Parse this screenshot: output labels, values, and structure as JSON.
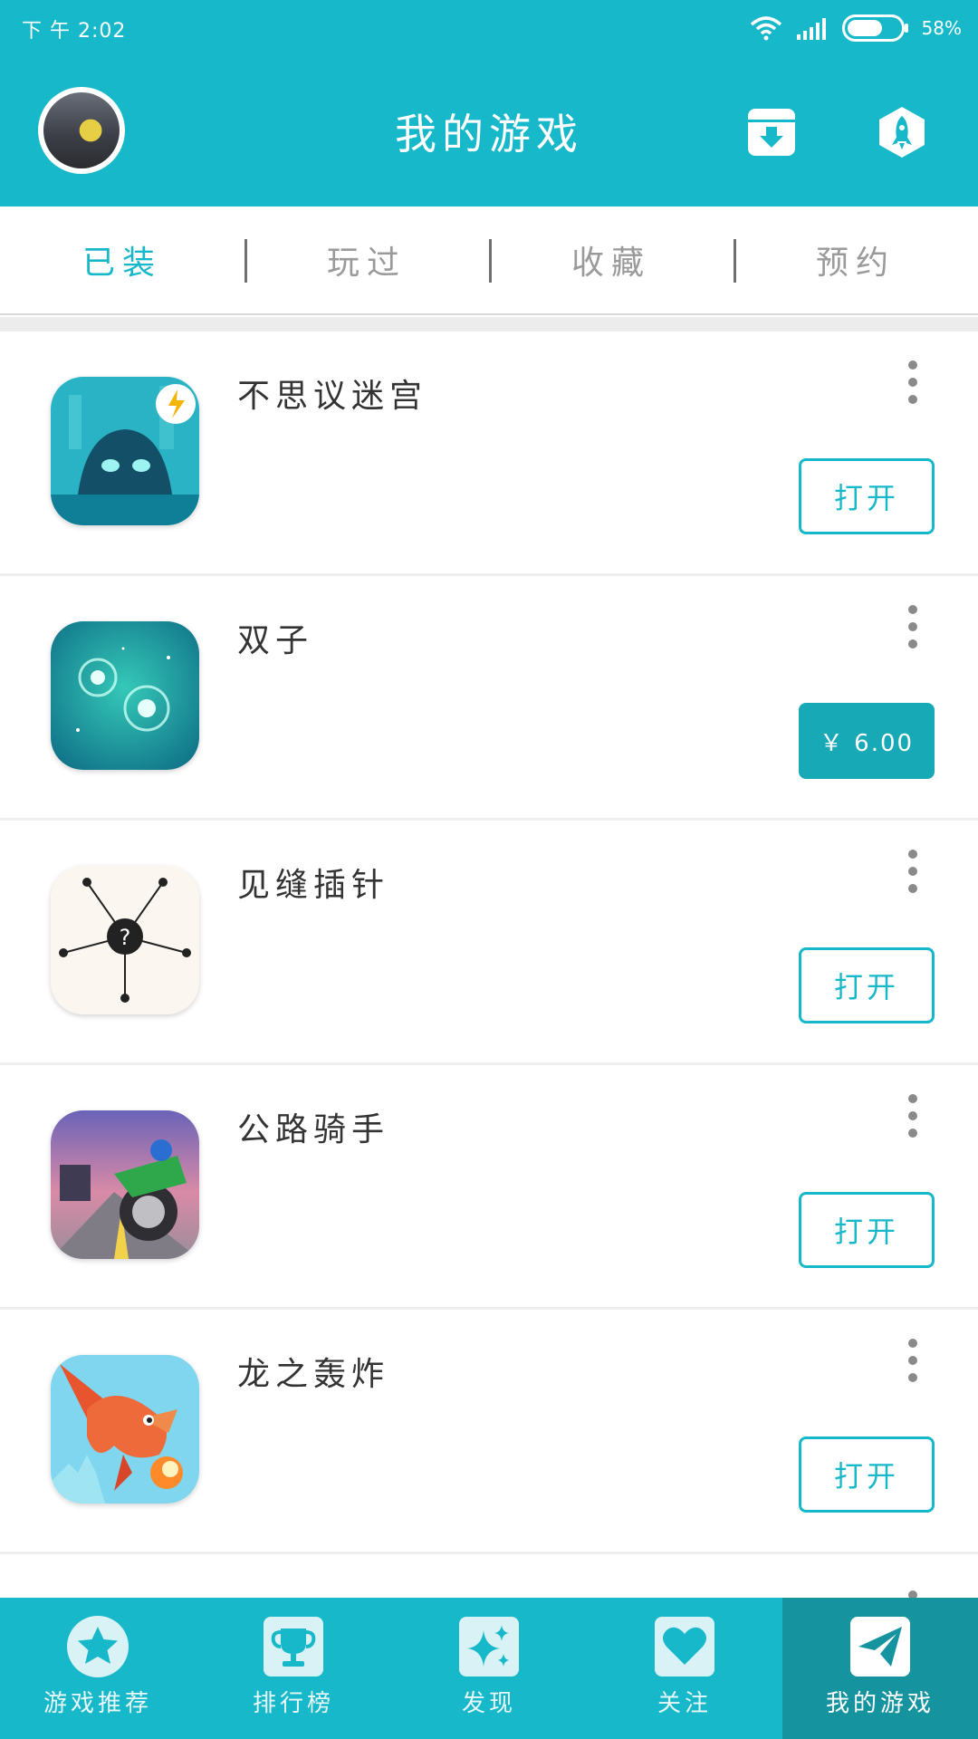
{
  "status_bar": {
    "time": "下 午 2:02",
    "battery": "58%"
  },
  "header": {
    "title": "我的游戏"
  },
  "tabs": [
    {
      "label": "已装",
      "active": true
    },
    {
      "label": "玩过",
      "active": false
    },
    {
      "label": "收藏",
      "active": false
    },
    {
      "label": "预约",
      "active": false
    }
  ],
  "games": [
    {
      "name": "不思议迷宫",
      "action": "打开",
      "icon": "dungeon-icon"
    },
    {
      "name": "双子",
      "action": "￥ 6.00",
      "icon": "twins-icon"
    },
    {
      "name": "见缝插针",
      "action": "打开",
      "icon": "pin-icon"
    },
    {
      "name": "公路骑手",
      "action": "打开",
      "icon": "rider-icon"
    },
    {
      "name": "龙之轰炸",
      "action": "打开",
      "icon": "dragon-icon"
    }
  ],
  "bottom_nav": [
    {
      "label": "游戏推荐",
      "icon": "star-icon",
      "active": false
    },
    {
      "label": "排行榜",
      "icon": "trophy-icon",
      "active": false
    },
    {
      "label": "发现",
      "icon": "sparkle-icon",
      "active": false
    },
    {
      "label": "关注",
      "icon": "heart-icon",
      "active": false
    },
    {
      "label": "我的游戏",
      "icon": "paper-plane-icon",
      "active": true
    }
  ],
  "colors": {
    "accent": "#17b8c9",
    "nav_active": "#15939f",
    "price_button": "#17a9b6"
  }
}
